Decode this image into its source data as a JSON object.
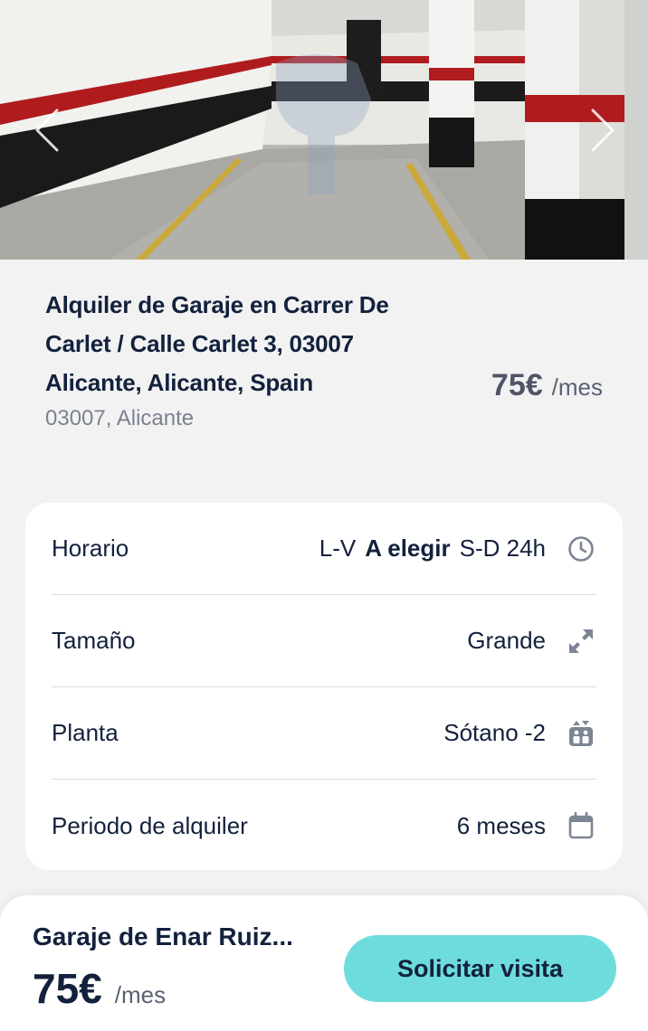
{
  "listing": {
    "title": "Alquiler de Garaje en Carrer De Carlet / Calle Carlet 3, 03007 Alicante, Alicante, Spain",
    "location": "03007, Alicante",
    "price": "75€",
    "price_unit": "/mes"
  },
  "details": {
    "schedule": {
      "label": "Horario",
      "value_prefix": "L-V",
      "value_bold": "A elegir",
      "value_suffix": "S-D 24h",
      "icon": "clock-icon"
    },
    "size": {
      "label": "Tamaño",
      "value": "Grande",
      "icon": "expand-icon"
    },
    "floor": {
      "label": "Planta",
      "value": "Sótano -2",
      "icon": "elevator-icon"
    },
    "period": {
      "label": "Periodo de alquiler",
      "value": "6 meses",
      "icon": "calendar-icon"
    }
  },
  "bottom_bar": {
    "owner": "Garaje de Enar Ruiz...",
    "price": "75€",
    "price_unit": "/mes",
    "cta_label": "Solicitar visita"
  },
  "colors": {
    "accent": "#6edcdc",
    "text_primary": "#13213d",
    "text_muted": "#7b8190",
    "icon": "#7d8494"
  }
}
